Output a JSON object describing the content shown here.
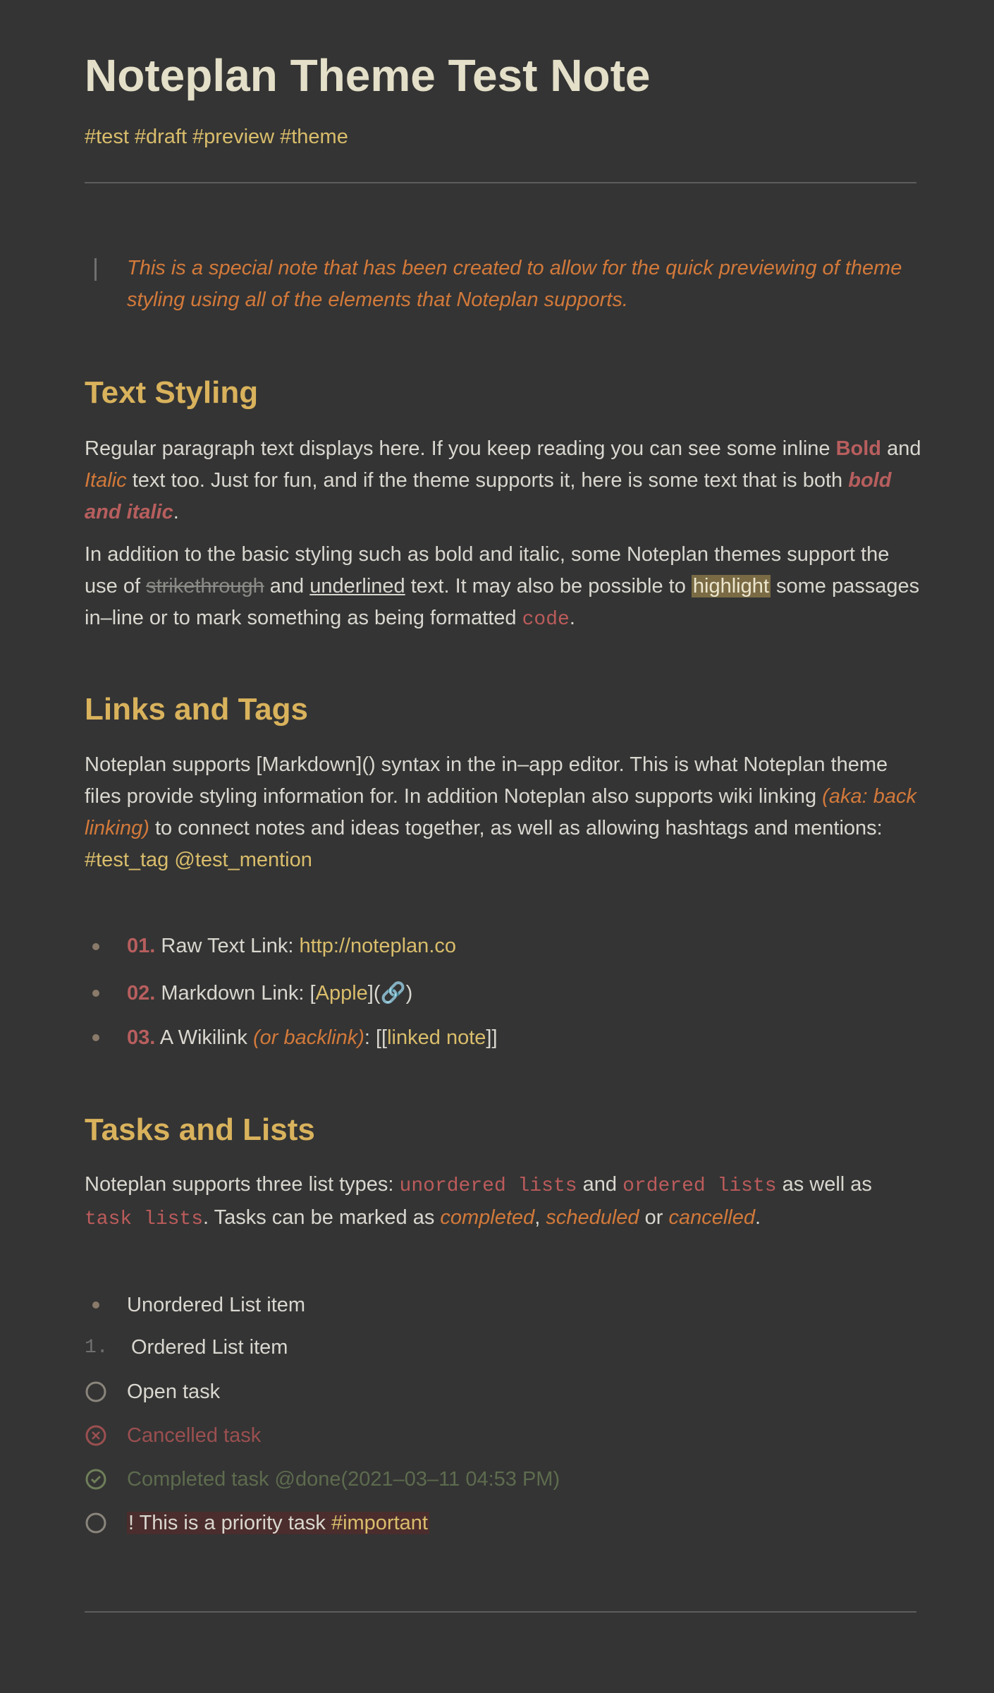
{
  "title": "Noteplan Theme Test Note",
  "tags": [
    "#test",
    "#draft",
    "#preview",
    "#theme"
  ],
  "quote": "This is a special note that has been created to allow for the quick previewing of theme styling using all of the elements that Noteplan supports.",
  "sections": {
    "text_styling": {
      "heading": "Text Styling",
      "p1_a": "Regular paragraph text displays here. If you keep reading you can see some inline",
      "p1_bold": "Bold",
      "p1_and": "and",
      "p1_italic": "Italic",
      "p1_b": "text too. Just for fun, and if the theme supports it, here is some text that is both",
      "p1_bolditalic": "bold and italic",
      "p1_end": ".",
      "p2_a": "In addition to the basic styling such as bold and italic, some Noteplan themes support the use of",
      "p2_strike": "strikethrough",
      "p2_and": "and",
      "p2_under": "underlined",
      "p2_b": "text. It may also be possible to",
      "p2_highlight": "highlight",
      "p2_c": "some passages in–line or to mark something as being formatted",
      "p2_code": "code",
      "p2_end": "."
    },
    "links_tags": {
      "heading": "Links and Tags",
      "p_a": "Noteplan supports [Markdown]() syntax in the in–app editor. This is what Noteplan theme files provide styling information for. In addition Noteplan also supports wiki linking",
      "p_italic": "(aka: back linking)",
      "p_b": "to connect notes and ideas together, as well as allowing hashtags and mentions:",
      "p_tag": "#test_tag",
      "p_mention": "@test_mention",
      "items": [
        {
          "num": "01.",
          "label": "Raw Text Link:",
          "link": "http://noteplan.co"
        },
        {
          "num": "02.",
          "label": "Markdown Link:",
          "open": "[",
          "link": "Apple",
          "close": "](",
          "icon": "🔗",
          "end": ")"
        },
        {
          "num": "03.",
          "label": "A Wikilink",
          "italic": "(or backlink)",
          "colon": ": [[",
          "link": "linked note",
          "end": "]]"
        }
      ]
    },
    "tasks_lists": {
      "heading": "Tasks and Lists",
      "p_a": "Noteplan supports three list types:",
      "code1": "unordered lists",
      "and": "and",
      "code2": "ordered lists",
      "as_well": "as well as",
      "code3": "task lists",
      "p_b": ". Tasks can be marked as",
      "completed": "completed",
      "comma": ",",
      "scheduled": "scheduled",
      "or": "or",
      "cancelled": "cancelled",
      "end": ".",
      "unordered_item": "Unordered List item",
      "ordered_num": "1.",
      "ordered_item": "Ordered List item",
      "open_task": "Open task",
      "cancelled_task": "Cancelled task",
      "completed_task": "Completed task @done(2021–03–11 04:53 PM)",
      "priority_task": "! This is a priority task",
      "priority_tag": "#important"
    }
  },
  "colors": {
    "background": "#343434",
    "text": "#d9d7cf",
    "heading": "#d9b25c",
    "tag": "#d9bd6b",
    "italic": "#d2793a",
    "bold": "#b85e5e"
  }
}
